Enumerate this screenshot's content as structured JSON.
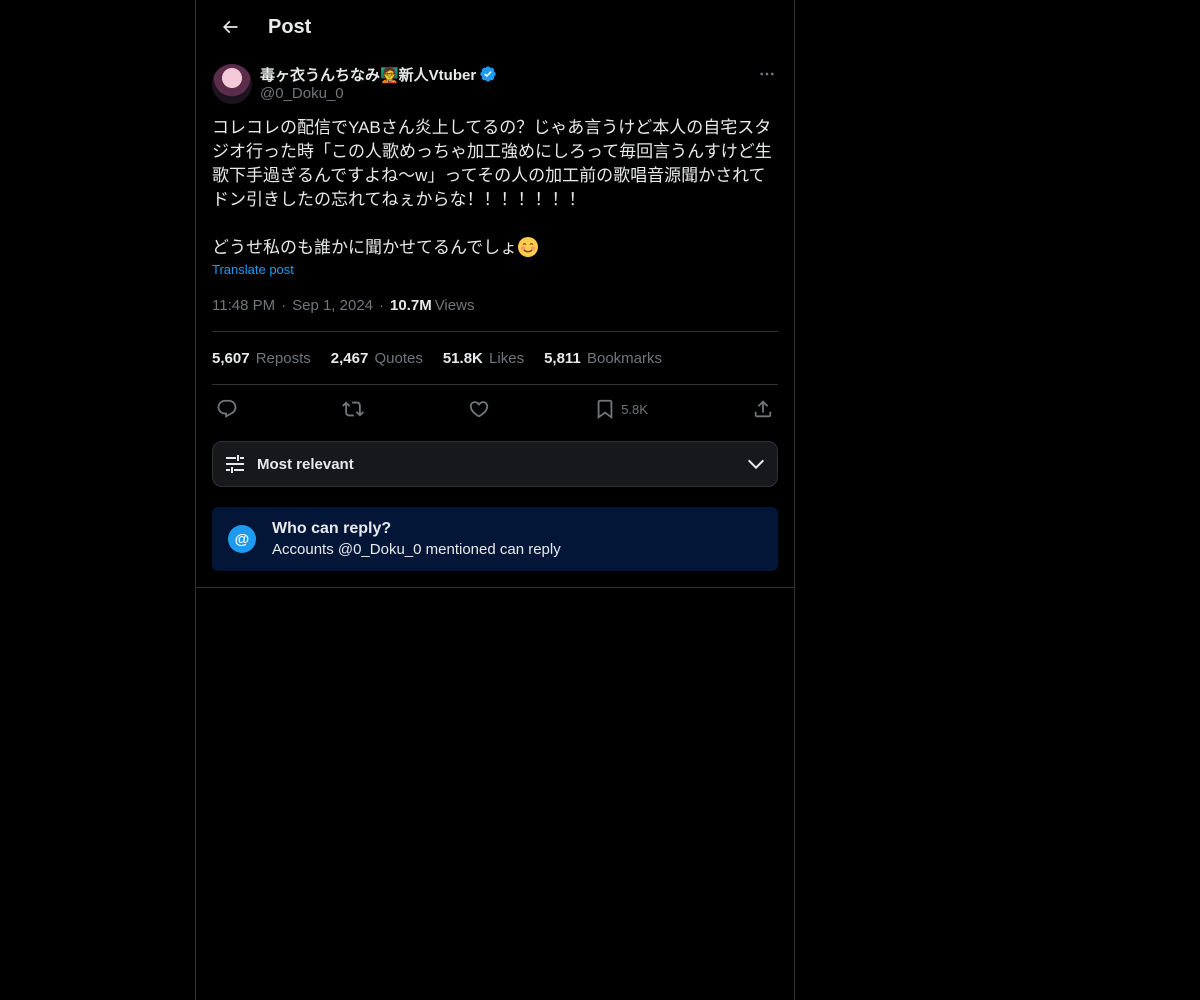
{
  "header": {
    "title": "Post",
    "back_icon": "arrow-left-icon"
  },
  "post": {
    "author": {
      "display_name": "毒ヶ衣うんちなみ🧑‍🏫新人Vtuber",
      "handle": "@0_Doku_0",
      "verified_icon": "verified-badge-icon",
      "verified_color": "#1d9bf0"
    },
    "more_icon": "more-horizontal-icon",
    "text": "コレコレの配信でYABさん炎上してるの？じゃあ言うけど本人の自宅スタジオ行った時「この人歌めっちゃ加工強めにしろって毎回言うんすけど生歌下手過ぎるんですよね〜w」ってその人の加工前の歌唱音源聞かされてドン引きしたの忘れてねぇからな！！！！！！！\n\nどうせ私のも誰かに聞かせてるんでしょ",
    "emoji": "☺️",
    "translate_label": "Translate post",
    "time": "11:48 PM",
    "date": "Sep 1, 2024",
    "views_count": "10.7M",
    "views_label": "Views"
  },
  "stats": {
    "reposts_count": "5,607",
    "reposts_label": "Reposts",
    "quotes_count": "2,467",
    "quotes_label": "Quotes",
    "likes_count": "51.8K",
    "likes_label": "Likes",
    "bookmarks_count": "5,811",
    "bookmarks_label": "Bookmarks"
  },
  "actions": {
    "reply_icon": "reply-icon",
    "repost_icon": "repost-icon",
    "like_icon": "heart-icon",
    "bookmark_icon": "bookmark-icon",
    "bookmark_count": "5.8K",
    "share_icon": "share-icon"
  },
  "sort": {
    "label": "Most relevant",
    "icon": "sliders-icon",
    "chevron_icon": "chevron-down-icon"
  },
  "reply_restriction": {
    "icon_text": "@",
    "title": "Who can reply?",
    "subtitle": "Accounts @0_Doku_0 mentioned can reply",
    "background": "#031637"
  },
  "colors": {
    "accent": "#1d9bf0",
    "background": "#000000",
    "border": "#2f3336",
    "muted_text": "#71767b"
  }
}
